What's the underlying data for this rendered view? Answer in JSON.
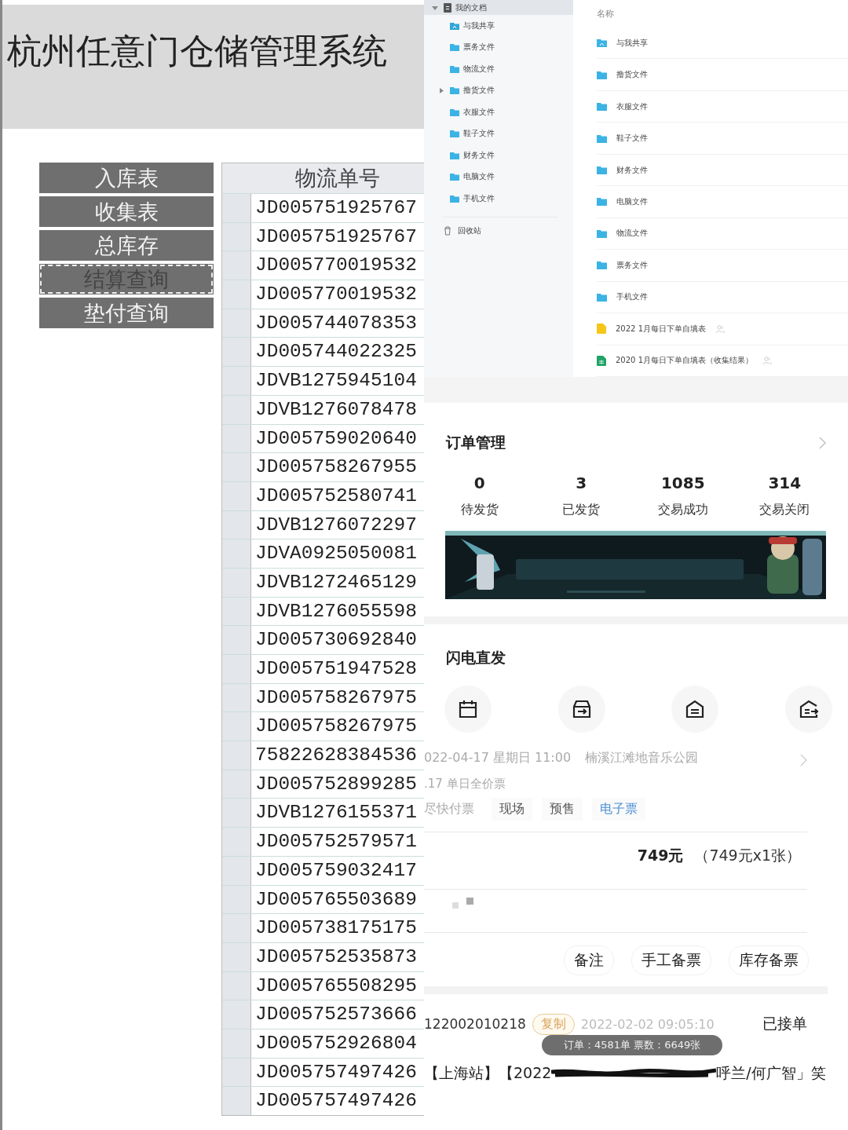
{
  "warehouse_app": {
    "title": "杭州任意门仓储管理系统",
    "nav_buttons": [
      {
        "label": "入库表",
        "selected": false
      },
      {
        "label": "收集表",
        "selected": false
      },
      {
        "label": "总库存",
        "selected": false
      },
      {
        "label": "结算查询",
        "selected": true
      },
      {
        "label": "垫付查询",
        "selected": false
      }
    ],
    "table": {
      "columns": [
        "物流单号"
      ],
      "rows": [
        "JD005751925767",
        "JD005751925767",
        "JD005770019532",
        "JD005770019532",
        "JD005744078353",
        "JD005744022325",
        "JDVB1275945104",
        "JDVB1276078478",
        "JD005759020640",
        "JD005758267955",
        "JD005752580741",
        "JDVB1276072297",
        "JDVA0925050081",
        "JDVB1272465129",
        "JDVB1276055598",
        "JD005730692840",
        "JD005751947528",
        "JD005758267975",
        "JD005758267975",
        "75822628384536",
        "JD005752899285",
        "JDVB1276155371",
        "JD005752579571",
        "JD005759032417",
        "JD005765503689",
        "JD005738175175",
        "JD005752535873",
        "JD005765508295",
        "JD005752573666",
        "JD005752926804",
        "JD005757497426",
        "JD005757497426"
      ]
    }
  },
  "file_manager": {
    "tree": {
      "label": "我的文档",
      "expanded": true,
      "selected": true,
      "children": [
        {
          "label": "与我共享",
          "kind": "shared",
          "expandable": false
        },
        {
          "label": "票务文件",
          "kind": "folder",
          "expandable": false
        },
        {
          "label": "物流文件",
          "kind": "folder",
          "expandable": false
        },
        {
          "label": "撸货文件",
          "kind": "folder",
          "expandable": true
        },
        {
          "label": "衣服文件",
          "kind": "folder",
          "expandable": false
        },
        {
          "label": "鞋子文件",
          "kind": "folder",
          "expandable": false
        },
        {
          "label": "财务文件",
          "kind": "folder",
          "expandable": false
        },
        {
          "label": "电脑文件",
          "kind": "folder",
          "expandable": false
        },
        {
          "label": "手机文件",
          "kind": "folder",
          "expandable": false
        }
      ]
    },
    "recycle_bin": "回收站",
    "list_header": "名称",
    "files": [
      {
        "name": "与我共享",
        "kind": "shared"
      },
      {
        "name": "撸货文件",
        "kind": "folder"
      },
      {
        "name": "衣服文件",
        "kind": "folder"
      },
      {
        "name": "鞋子文件",
        "kind": "folder"
      },
      {
        "name": "财务文件",
        "kind": "folder"
      },
      {
        "name": "电脑文件",
        "kind": "folder"
      },
      {
        "name": "物流文件",
        "kind": "folder"
      },
      {
        "name": "票务文件",
        "kind": "folder"
      },
      {
        "name": "手机文件",
        "kind": "folder"
      },
      {
        "name": "2022 1月每日下单自填表",
        "kind": "doc"
      },
      {
        "name": "2020 1月每日下单自填表（收集结果）",
        "kind": "sheet"
      }
    ]
  },
  "shop": {
    "orders": {
      "title": "订单管理",
      "stats": [
        {
          "value": "0",
          "label": "待发货"
        },
        {
          "value": "3",
          "label": "已发货"
        },
        {
          "value": "1085",
          "label": "交易成功"
        },
        {
          "value": "314",
          "label": "交易关闭"
        }
      ]
    },
    "express": {
      "title": "闪电直发",
      "shortcuts": [
        {
          "kind": "calendar"
        },
        {
          "kind": "box"
        },
        {
          "kind": "house"
        },
        {
          "kind": "export"
        }
      ]
    }
  },
  "tickets": {
    "event_time": "022-04-17 星期日 11:00",
    "venue": "楠溪江滩地音乐公园",
    "ticket_type": ".17 单日全价票",
    "tags": [
      {
        "label": "尽快付票",
        "kind": "plain"
      },
      {
        "label": "现场",
        "kind": "chip"
      },
      {
        "label": "预售",
        "kind": "chip"
      },
      {
        "label": "电子票",
        "kind": "highlight"
      }
    ],
    "price": "749元",
    "price_detail": "（749元x1张）",
    "actions": [
      "备注",
      "手工备票",
      "库存备票"
    ],
    "order": {
      "number": "122002010218",
      "copy_label": "复制",
      "time": "2022-02-02 09:05:10",
      "status": "已接单",
      "title_start": "【上海站】【2022",
      "title_end": "呼兰/何广智」笑"
    },
    "toast": "订单：4581单 票数：6649张"
  }
}
